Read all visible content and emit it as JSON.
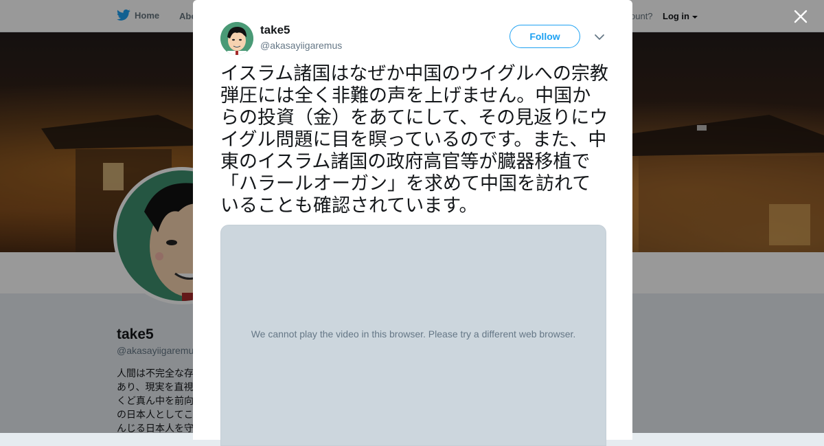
{
  "topbar": {
    "home_label": "Home",
    "about_label": "Abo",
    "account_prompt": "ccount?",
    "login_label": "Log in"
  },
  "profile": {
    "name": "take5",
    "handle": "@akasayiigaremus",
    "bio_lines": [
      "人間は不完全な存",
      "あり、現実を直視",
      "くど真ん中を前向",
      "の日本人としてこ",
      "んじる日本人を守"
    ]
  },
  "tweet": {
    "author_name": "take5",
    "author_handle": "@akasayiigaremus",
    "follow_label": "Follow",
    "text": "イスラム諸国はなぜか中国のウイグルへの宗教弾圧には全く非難の声を上げません。中国からの投資（金）をあてにして、その見返りにウイグル問題に目を瞑っているのです。また、中東のイスラム諸国の政府高官等が臓器移植で「ハラールオーガン」を求めて中国を訪れていることも確認されています。",
    "video_error": "We cannot play the video in this browser. Please try a different web browser."
  },
  "icons": {
    "logo": "twitter-bird-icon",
    "close": "close-icon",
    "caret": "chevron-down-icon"
  },
  "colors": {
    "brand": "#1da1f2",
    "text_primary": "#14171a",
    "text_secondary": "#657786",
    "media_bg": "#ccd6dd"
  }
}
